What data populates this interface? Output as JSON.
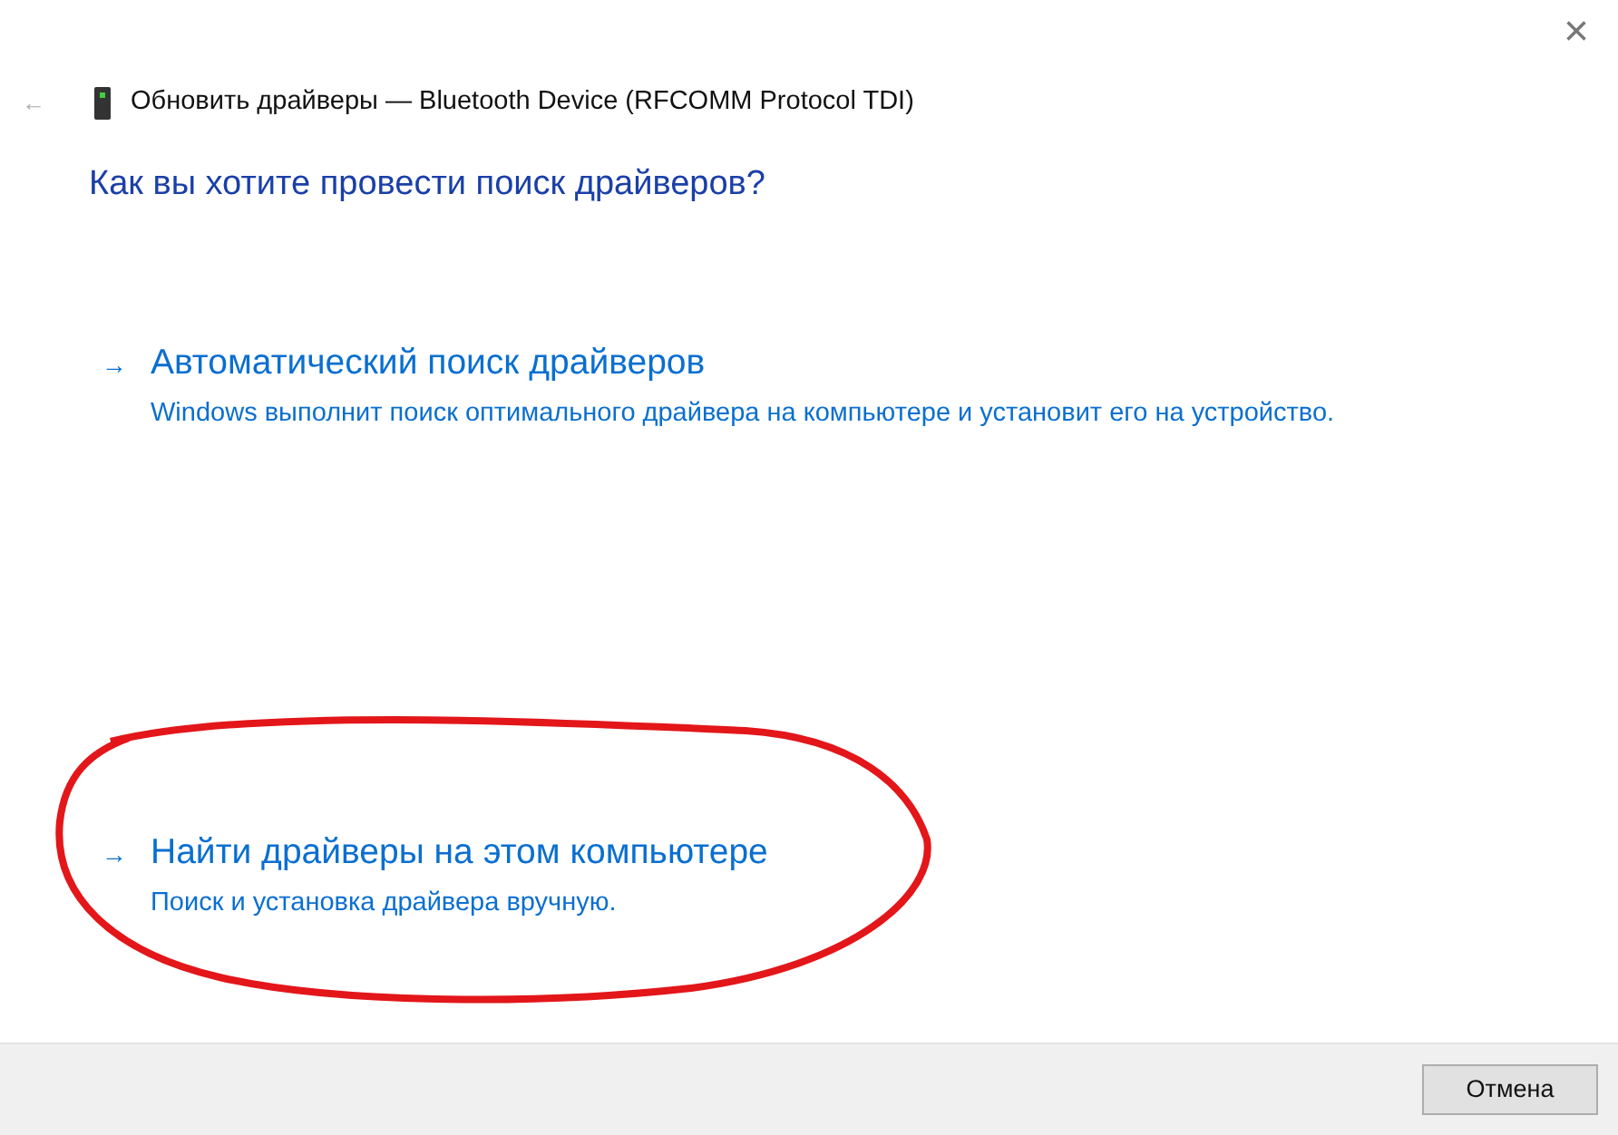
{
  "window": {
    "title": "Обновить драйверы — Bluetooth Device (RFCOMM Protocol TDI)",
    "back": "←",
    "close": "×"
  },
  "heading": "Как вы хотите провести поиск драйверов?",
  "options": [
    {
      "arrow": "→",
      "title": "Автоматический поиск драйверов",
      "description": "Windows выполнит поиск оптимального драйвера на компьютере и установит его на устройство.",
      "circled": false
    },
    {
      "arrow": "→",
      "title": "Найти драйверы на этом компьютере",
      "description": "Поиск и установка драйвера вручную.",
      "circled": true
    }
  ],
  "buttons": [
    "Отмена"
  ]
}
